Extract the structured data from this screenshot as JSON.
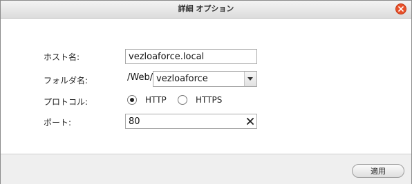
{
  "dialog": {
    "title": "詳細 オプション",
    "close_icon": "close-icon"
  },
  "form": {
    "host": {
      "label": "ホスト名:",
      "value": "vezloaforce.local"
    },
    "folder": {
      "label": "フォルダ名:",
      "prefix": "/Web/",
      "selected": "vezloaforce"
    },
    "protocol": {
      "label": "プロトコル:",
      "options": [
        "HTTP",
        "HTTPS"
      ],
      "selected": "HTTP"
    },
    "port": {
      "label": "ポート:",
      "value": "80"
    }
  },
  "footer": {
    "apply_label": "適用"
  },
  "colors": {
    "close_button": "#e8512a",
    "footer_bg": "#efefef",
    "titlebar_bg": "#e6e6e6"
  }
}
